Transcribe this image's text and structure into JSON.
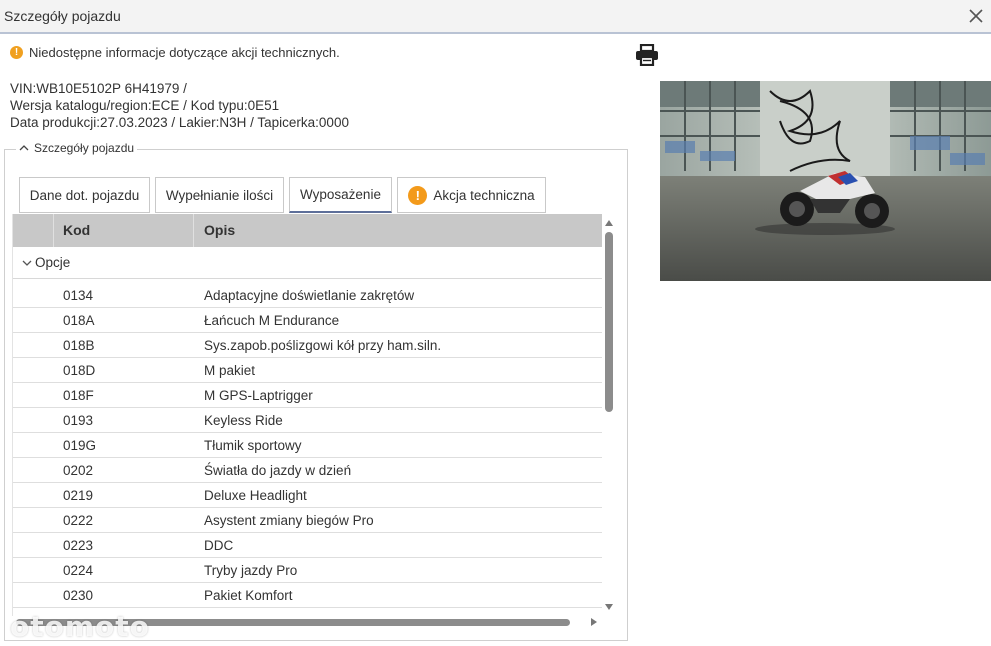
{
  "window": {
    "title": "Szczegóły pojazdu"
  },
  "warning": "Niedostępne informacje dotyczące akcji technicznych.",
  "info_lines": [
    "VIN:WB10E5102P 6H41979 /",
    "Wersja katalogu/region:ECE / Kod typu:0E51",
    "Data produkcji:27.03.2023 / Lakier:N3H / Tapicerka:0000"
  ],
  "section": {
    "label": "Szczegóły pojazdu"
  },
  "tabs": [
    {
      "label": "Dane dot. pojazdu"
    },
    {
      "label": "Wypełnianie ilości"
    },
    {
      "label": "Wyposażenie"
    },
    {
      "label": "Akcja techniczna"
    }
  ],
  "grid": {
    "columns": {
      "kod": "Kod",
      "opis": "Opis"
    },
    "group": "Opcje",
    "rows": [
      {
        "kod": "0134",
        "opis": "Adaptacyjne doświetlanie zakrętów"
      },
      {
        "kod": "018A",
        "opis": "Łańcuch M Endurance"
      },
      {
        "kod": "018B",
        "opis": "Sys.zapob.poślizgowi kół przy ham.siln."
      },
      {
        "kod": "018D",
        "opis": "M pakiet"
      },
      {
        "kod": "018F",
        "opis": "M GPS-Laptrigger"
      },
      {
        "kod": "0193",
        "opis": "Keyless Ride"
      },
      {
        "kod": "019G",
        "opis": "Tłumik sportowy"
      },
      {
        "kod": "0202",
        "opis": "Światła do jazdy w dzień"
      },
      {
        "kod": "0219",
        "opis": "Deluxe Headlight"
      },
      {
        "kod": "0222",
        "opis": "Asystent zmiany biegów Pro"
      },
      {
        "kod": "0223",
        "opis": "DDC"
      },
      {
        "kod": "0224",
        "opis": "Tryby jazdy Pro"
      },
      {
        "kod": "0230",
        "opis": "Pakiet Komfort"
      }
    ]
  },
  "watermark": "otomoto",
  "colors": {
    "accent": "#5d6f9a",
    "warning": "#f39a1a",
    "header_bg": "#c8c8c8"
  },
  "icons": {
    "close": "close-icon",
    "print": "printer-icon",
    "warning": "warning-icon",
    "collapse": "chevron-up-icon",
    "group": "chevron-down-icon"
  }
}
